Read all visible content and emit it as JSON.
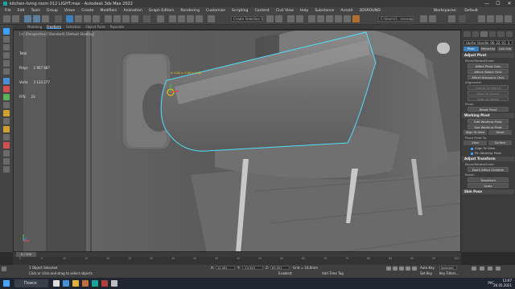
{
  "window": {
    "title": "kitchen-living room 012 LIGHT.max - Autodesk 3ds Max 2022",
    "controls": [
      "—",
      "☐",
      "✕"
    ]
  },
  "menu": {
    "items": [
      "File",
      "Edit",
      "Tools",
      "Group",
      "Views",
      "Create",
      "Modifiers",
      "Animation",
      "Graph Editors",
      "Rendering",
      "Customize",
      "Scripting",
      "Content",
      "Civil View",
      "Help",
      "Substance",
      "Arnold",
      "3DSROUND"
    ],
    "workspaces_label": "Workspaces:",
    "workspace_value": "Default"
  },
  "toolbar": {
    "selection_set": "Create Selection Se",
    "path_field": "C:\\Users\\1...\\rosnapaz.s..."
  },
  "ribbon": {
    "tabs": [
      "Modeling",
      "Freeform",
      "Selection",
      "Object Paint",
      "Populate"
    ],
    "active_tab": "Freeform"
  },
  "viewport": {
    "label": "[+] [Perspective] [Standard] [Default Shading]",
    "stats_total_label": "Total",
    "stats": [
      {
        "label": "Polys:",
        "value": "1 957 687"
      },
      {
        "label": "Verts:",
        "value": "3 133 277"
      }
    ],
    "fps_label": "FPS:",
    "fps_value": "23",
    "pivot_readout": "x: 0.00 y: 0.00 z: 0.00"
  },
  "command_panel": {
    "object_name": "Uprite_Handle_06_22_01_3",
    "tab_buttons": [
      "Pivot",
      "Hierarchy",
      "Link Info"
    ],
    "adjust_pivot": {
      "title": "Adjust Pivot",
      "move_rotate_scale": "Move/Rotate/Scale:",
      "buttons": [
        "Affect Pivot Only",
        "Affect Object Only",
        "Affect Hierarchy Only"
      ],
      "alignment_label": "Alignment:",
      "align_buttons": [
        "Center to Object",
        "Align to Object",
        "Align to World"
      ],
      "pivot_label": "Pivot:",
      "reset_pivot": "Reset Pivot"
    },
    "working_pivot": {
      "title": "Working Pivot",
      "buttons": [
        "Edit Working Pivot",
        "Use Working Pivot"
      ],
      "align_to_view": "Align To View",
      "reset": "Reset",
      "place_pivot_to": "Place Pivot To:",
      "view": "View",
      "surface": "Surface",
      "align_checkbox": "Align To View",
      "pin_checkbox": "Pin Working Pivot"
    },
    "adjust_transform": {
      "title": "Adjust Transform",
      "move_rotate_scale": "Move/Rotate/Scale:",
      "dont_affect_children": "Don't Affect Children",
      "reset_label": "Reset:",
      "transform_button": "Transform",
      "scale_button": "Scale"
    },
    "skin_pose": "Skin Pose"
  },
  "timeline": {
    "frame_readout": "0 / 100",
    "ticks": [
      "0",
      "5",
      "10",
      "15",
      "20",
      "25",
      "30",
      "35",
      "40",
      "45",
      "50",
      "55",
      "60",
      "65",
      "70",
      "75",
      "80",
      "85",
      "90",
      "95",
      "100"
    ]
  },
  "statusbar": {
    "selection": "1 Object Selected",
    "prompt": "Click or click-and-drag to select objects",
    "x_label": "X:",
    "x_value": "12,561",
    "y_label": "Y:",
    "y_value": "-74,343",
    "z_label": "Z:",
    "z_value": "83,551",
    "grid": "Grid = 10,0mm",
    "enabled": "Enabled:",
    "add_time_tag": "Add Time Tag",
    "auto_key": "Auto Key",
    "set_key": "Set Key",
    "selected": "Selected",
    "key_filters": "Key Filters..."
  },
  "taskbar": {
    "search": "Поиск",
    "lang": "РУС",
    "time": "13:07",
    "date": "26.05.2021"
  },
  "colors": {
    "accent": "#3da0ff",
    "selection_outline": "#4fe0ff",
    "viewport_bg": "#5a5a5a"
  }
}
